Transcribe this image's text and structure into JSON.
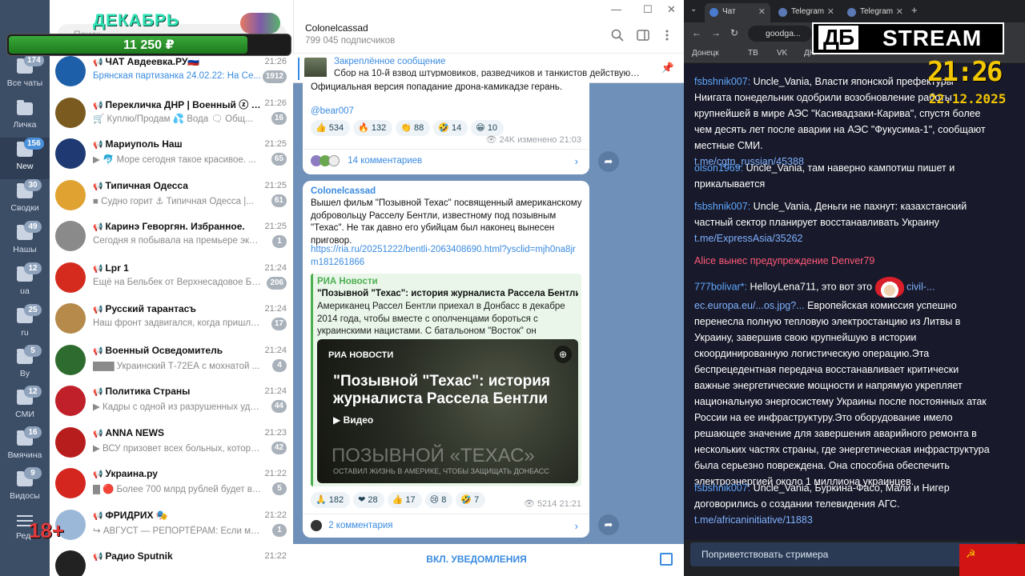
{
  "folders": [
    {
      "label": "Все чаты",
      "badge": "174"
    },
    {
      "label": "Личка",
      "badge": ""
    },
    {
      "label": "New",
      "badge": "156"
    },
    {
      "label": "Сводки",
      "badge": "30"
    },
    {
      "label": "Нашы",
      "badge": "49"
    },
    {
      "label": "ua",
      "badge": "12"
    },
    {
      "label": "ru",
      "badge": "25"
    },
    {
      "label": "By",
      "badge": "5"
    },
    {
      "label": "СМИ",
      "badge": "12"
    },
    {
      "label": "Вмячина",
      "badge": "16"
    },
    {
      "label": "Видосы",
      "badge": "9"
    },
    {
      "label": "Ред",
      "badge": ""
    }
  ],
  "overlay": {
    "age": "18+",
    "promo_title": "ДЕКАБРЬ",
    "promo_amount": "11 250 ₽",
    "promo_fill": 0.85,
    "search_placeholder": "Поиск"
  },
  "chats": [
    {
      "name": "ЧАТ Авдеевка.РУ🇷🇺",
      "time": "21:26",
      "preview": "Брянская партизанка 24.02.22: На Се...",
      "unread": "1912",
      "color": "#1d5fa8",
      "blue": true
    },
    {
      "name": "Перекличка ДНР | Военный ⓩ До...",
      "time": "21:26",
      "preview": "🛒 Куплю/Продам  💦 Вода  🗨 Общ...",
      "unread": "16",
      "color": "#7a5a1e",
      "blue": false
    },
    {
      "name": "Мариуполь Наш",
      "time": "21:25",
      "preview": "▶ 🐬 Море сегодня такое красивое. ...",
      "unread": "65",
      "color": "#1f3a73",
      "blue": false
    },
    {
      "name": "Типичная Одесса",
      "time": "21:25",
      "preview": "■ Судно горит ⚓ Типичная Одесса |...",
      "unread": "61",
      "color": "#e0a331",
      "blue": false
    },
    {
      "name": "Каринэ Геворгян. Избранное.",
      "time": "21:25",
      "preview": "Сегодня я побывала на премьере экран...",
      "unread": "1",
      "color": "#8a8a8a",
      "blue": false
    },
    {
      "name": "Lpr 1",
      "time": "21:24",
      "preview": "Ещё на Бельбек от Верхнесадовое БПЛА",
      "unread": "206",
      "color": "#d52b1e",
      "blue": false
    },
    {
      "name": "Русский тарантасъ",
      "time": "21:24",
      "preview": "Наш фронт задвигался, когда пришло п...",
      "unread": "17",
      "color": "#b58a4a",
      "blue": false
    },
    {
      "name": "Военный Осведомитель",
      "time": "21:24",
      "preview": "▇▇▇ Украинский Т-72ЕА с мохнатой ...",
      "unread": "4",
      "color": "#2e6b2e",
      "blue": false
    },
    {
      "name": "Политика Страны",
      "time": "21:24",
      "preview": "▶ Кадры с одной из разрушенных уда...",
      "unread": "44",
      "color": "#c0202a",
      "blue": false
    },
    {
      "name": "ANNA NEWS",
      "time": "21:23",
      "preview": "▶ ВСУ призовет всех больных, которы...",
      "unread": "42",
      "color": "#b81d1d",
      "blue": false
    },
    {
      "name": "Украина.ру",
      "time": "21:22",
      "preview": "▇ 🔴 Более 700 млрд рублей будет вло...",
      "unread": "5",
      "color": "#d4261f",
      "blue": false
    },
    {
      "name": "ФРИДРИХ 🎭",
      "time": "21:22",
      "preview": "↪ АВГУСТ — РЕПОРТЁРАМ: Если мол...",
      "unread": "1",
      "color": "#9bb8d8",
      "blue": false
    },
    {
      "name": "Радио Sputnik",
      "time": "21:22",
      "preview": "",
      "unread": "",
      "color": "#222222",
      "blue": false
    }
  ],
  "channel": {
    "title": "Colonelcassad",
    "subscribers": "799 045 подписчиков",
    "pinned_title": "Закреплённое сообщение",
    "pinned_text": "Сбор на 10-й взвод штурмовиков, разведчиков и танкистов действующи...",
    "notify_button": "ВКЛ. УВЕДОМЛЕНИЯ"
  },
  "post1": {
    "text": "Официальная версия попадание дрона-камикадзе герань.",
    "signature": "@bear007",
    "reactions": [
      {
        "emoji": "👍",
        "count": "534"
      },
      {
        "emoji": "🔥",
        "count": "132"
      },
      {
        "emoji": "👏",
        "count": "88"
      },
      {
        "emoji": "🤣",
        "count": "14"
      },
      {
        "emoji": "😁",
        "count": "10"
      }
    ],
    "views": "👁 24K  изменено 21:03",
    "comments": "14 комментариев"
  },
  "post2": {
    "author": "Colonelcassad",
    "text": "Вышел фильм \"Позывной Техас\" посвященный американскому добровольцу Расселу Бентли, известному под позывным \"Техас\". Не так давно его убийцам был наконец вынесен приговор.",
    "link": "https://ria.ru/20251222/bentli-2063408690.html?ysclid=mjh0na8jrm181261866",
    "preview_site": "РИА Новости",
    "preview_title": "\"Позывной \"Техас\": история журналиста Рассела Бентли",
    "preview_desc": "Американец Рассел Бентли приехал в Донбасс в декабре 2014 года, чтобы вместе с ополченцами бороться с украинскими нацистами. С батальоном \"Восток\" он сражался... РИА Новос...",
    "image_logo": "РИА НОВОСТИ",
    "image_heading": "\"Позывной \"Техас\": история журналиста Рассела Бентли",
    "image_video": "▶ Видео",
    "image_big": "ПОЗЫВНОЙ «ТЕХАС»",
    "image_small": "ОСТАВИЛ ЖИЗНЬ В АМЕРИКЕ, ЧТОБЫ ЗАЩИЩАТЬ ДОНБАСС",
    "reactions": [
      {
        "emoji": "🙏",
        "count": "182"
      },
      {
        "emoji": "❤",
        "count": "28"
      },
      {
        "emoji": "👍",
        "count": "17"
      },
      {
        "emoji": "😢",
        "count": "8"
      },
      {
        "emoji": "🤣",
        "count": "7"
      }
    ],
    "views": "👁 5214  21:21",
    "comments": "2 комментария"
  },
  "browser": {
    "tabs": [
      "Чат",
      "Telegram",
      "Telegram"
    ],
    "url": "goodga...",
    "bookmarks": [
      "Донецк",
      "ТВ",
      "VK",
      "ДН"
    ]
  },
  "stream": {
    "logo_left": "ДБ",
    "logo_right": "STREAM",
    "clock": "21:26",
    "date": "22.12.2025",
    "input_placeholder": "Поприветствовать стримера",
    "flag": "☭",
    "messages": [
      {
        "nick": "fsbshnik007:",
        "text": " Uncle_Vania, Власти японской префектуры Ниигата понедельник одобрили возобновление работы крупнейшей в мире АЭС \"Касивадзаки-Карива\", спустя более чем десять лет после аварии на АЭС \"Фукусима-1\", сообщают местные СМИ.",
        "link": "t.me/cgtn_russian/45388"
      },
      {
        "nick": "olson1969:",
        "text": " Uncle_Vania, там наверно кампотиш пишет и прикалывается",
        "link": ""
      },
      {
        "nick": "fsbshnik007:",
        "text": " Uncle_Vania, Деньги не пахнут: казахстанский частный сектор планирует восстанавливать Украину",
        "link": "t.me/ExpressAsia/35262"
      },
      {
        "warn": "Alice вынес предупреждение Denver79"
      },
      {
        "nick": "777bolivar*:",
        "text": " HelloyLena711, это вот это",
        "link": "civil-... ec.europa.eu/...os.jpg?...",
        "text2": " Европейская комиссия успешно перенесла полную тепловую электростанцию из Литвы в Украину, завершив свою крупнейшую в истории скоординированную логистическую операцию.Эта беспрецедентная передача восстанавливает критически важные энергетические мощности и напрямую укрепляет национальную энергосистему Украины после постоянных атак России на ее инфраструктуру.Это оборудование имело решающее значение для завершения аварийного ремонта в нескольких частях страны, где энергетическая инфраструктура была серьезно повреждена. Она способна обеспечить электроэнергией около 1 миллиона украинцев."
      },
      {
        "nick": "fsbshnik007:",
        "text": " Uncle_Vania, Буркина-Фасо, Мали и Нигер договорились о создании телевидения АГС.",
        "link": "t.me/africaninitiative/11883"
      }
    ]
  }
}
